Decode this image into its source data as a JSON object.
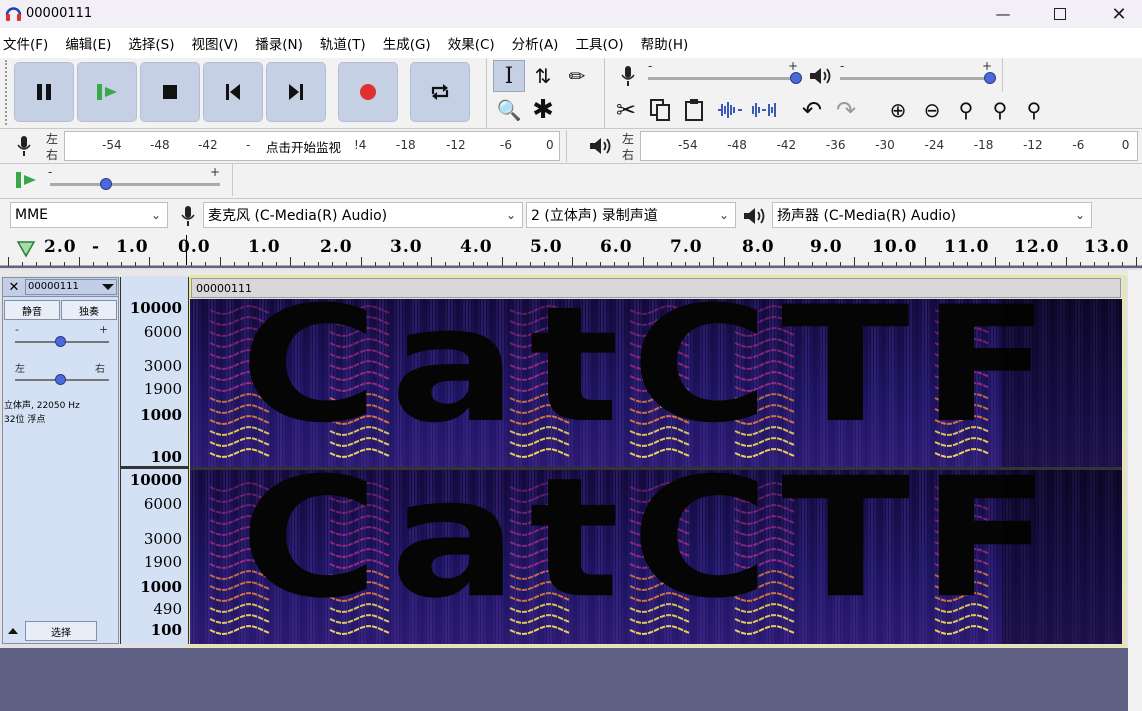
{
  "window": {
    "title": "00000111"
  },
  "menu": [
    "文件(F)",
    "编辑(E)",
    "选择(S)",
    "视图(V)",
    "播录(N)",
    "轨道(T)",
    "生成(G)",
    "效果(C)",
    "分析(A)",
    "工具(O)",
    "帮助(H)"
  ],
  "meters": {
    "rec_lr": [
      "左",
      "右"
    ],
    "rec_ticks": [
      "-54",
      "-48",
      "-42",
      "-"
    ],
    "rec_click": "点击开始监视",
    "rec_ticks2": [
      "!4",
      "-18",
      "-12",
      "-6",
      "0"
    ],
    "play_ticks": [
      "-54",
      "-48",
      "-42",
      "-36",
      "-30",
      "-24",
      "-18",
      "-12",
      "-6",
      "0"
    ],
    "slider_minus": "-",
    "slider_plus": "+"
  },
  "devices": {
    "host": "MME",
    "input": "麦克风 (C-Media(R) Audio)",
    "channels": "2 (立体声) 录制声道",
    "output": "扬声器 (C-Media(R) Audio)"
  },
  "timeline": {
    "labels": [
      "2.0",
      "-",
      "1.0",
      "0.0",
      "1.0",
      "2.0",
      "3.0",
      "4.0",
      "5.0",
      "6.0",
      "7.0",
      "8.0",
      "9.0",
      "10.0",
      "11.0",
      "12.0",
      "13.0"
    ]
  },
  "track": {
    "name": "00000111",
    "clip_name": "00000111",
    "mute": "静音",
    "solo": "独奏",
    "gain_minus": "-",
    "gain_plus": "+",
    "pan_left": "左",
    "pan_right": "右",
    "info_line1": "立体声, 22050 Hz",
    "info_line2": "32位 浮点",
    "select": "选择",
    "axis_top": [
      "10000",
      "6000",
      "3000",
      "1900",
      "1000",
      "100"
    ],
    "axis_bottom": [
      "10000",
      "6000",
      "3000",
      "1900",
      "1000",
      "490",
      "100"
    ],
    "spectrogram_text": "CatCTF"
  },
  "colors": {
    "accent": "#c6d0e4",
    "track_bg": "#d4e0f4",
    "record": "#e0302e",
    "play_green": "#3aa84a"
  }
}
